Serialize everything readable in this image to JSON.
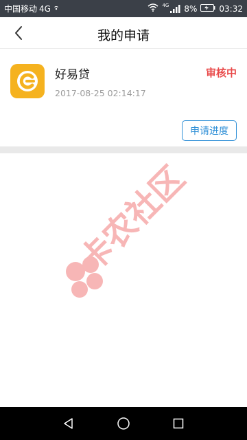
{
  "status_bar": {
    "carrier": "中国移动",
    "network_type": "4G",
    "signal_label": "4G",
    "battery": "8%",
    "time": "03:32"
  },
  "header": {
    "title": "我的申请",
    "back_icon": "chevron-left-icon"
  },
  "application": {
    "name": "好易贷",
    "date": "2017-08-25 02:14:17",
    "status": "审核中",
    "progress_button": "申请进度",
    "logo_icon": "loan-app-logo-icon",
    "logo_color": "#f5b21f"
  },
  "watermark": {
    "text": "卡农社区"
  },
  "nav_bar": {
    "back_icon": "triangle-back-icon",
    "home_icon": "circle-home-icon",
    "recent_icon": "square-recents-icon"
  },
  "colors": {
    "status_red": "#e94b4b",
    "accent_blue": "#2c8ed6",
    "status_bar_bg": "#3b4048"
  }
}
